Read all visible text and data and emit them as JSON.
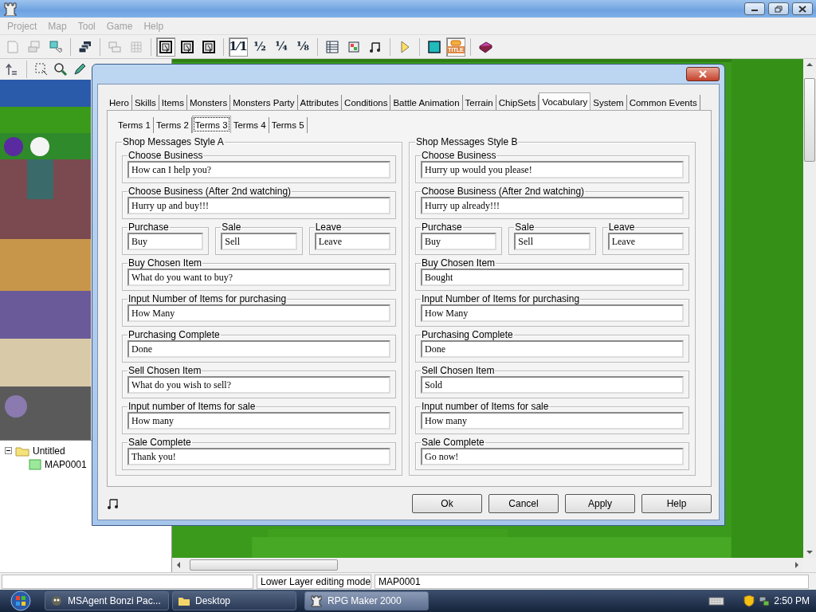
{
  "menu": [
    {
      "label": "Project",
      "disabled": true
    },
    {
      "label": "Map",
      "disabled": true
    },
    {
      "label": "Tool",
      "disabled": true
    },
    {
      "label": "Game",
      "disabled": true
    },
    {
      "label": "Help",
      "disabled": true
    }
  ],
  "toolbar": {
    "layer_buttons": [
      {
        "selected": true
      },
      {
        "selected": false
      },
      {
        "selected": false
      }
    ],
    "zoom_buttons": [
      {
        "label": "1⁄1",
        "selected": true
      },
      {
        "label": "½",
        "selected": false
      },
      {
        "label": "¼",
        "selected": false
      },
      {
        "label": "⅛",
        "selected": false
      }
    ],
    "title_button": {
      "label": "TITLE",
      "on": true
    }
  },
  "map_tree": [
    {
      "label": "Untitled",
      "expanded": true,
      "children": [
        {
          "label": "MAP0001"
        }
      ]
    }
  ],
  "dialog": {
    "tabs": [
      {
        "label": "Hero",
        "selected": false
      },
      {
        "label": "Skills",
        "selected": false
      },
      {
        "label": "Items",
        "selected": false
      },
      {
        "label": "Monsters",
        "selected": false
      },
      {
        "label": "Monsters Party",
        "selected": false
      },
      {
        "label": "Attributes",
        "selected": false
      },
      {
        "label": "Conditions",
        "selected": false
      },
      {
        "label": "Battle Animation",
        "selected": false
      },
      {
        "label": "Terrain",
        "selected": false
      },
      {
        "label": "ChipSets",
        "selected": false
      },
      {
        "label": "Vocabulary",
        "selected": true
      },
      {
        "label": "System",
        "selected": false
      },
      {
        "label": "Common Events",
        "selected": false
      }
    ],
    "subtabs": [
      {
        "label": "Terms 1",
        "selected": false
      },
      {
        "label": "Terms 2",
        "selected": false
      },
      {
        "label": "Terms 3",
        "selected": true
      },
      {
        "label": "Terms 4",
        "selected": false
      },
      {
        "label": "Terms 5",
        "selected": false
      }
    ],
    "groups": [
      {
        "title": "Shop Messages Style A",
        "fields": [
          {
            "kind": "single",
            "label": "Choose Business",
            "value": "How can I help you?"
          },
          {
            "kind": "single",
            "label": "Choose Business (After 2nd watching)",
            "value": "Hurry up and buy!!!"
          },
          {
            "kind": "triple",
            "items": [
              {
                "label": "Purchase",
                "value": "Buy"
              },
              {
                "label": "Sale",
                "value": "Sell"
              },
              {
                "label": "Leave",
                "value": "Leave"
              }
            ]
          },
          {
            "kind": "single",
            "label": "Buy Chosen Item",
            "value": "What do you want to buy?"
          },
          {
            "kind": "single",
            "label": "Input Number of Items for purchasing",
            "value": "How Many"
          },
          {
            "kind": "single",
            "label": "Purchasing Complete",
            "value": "Done"
          },
          {
            "kind": "single",
            "label": "Sell Chosen Item",
            "value": "What do you wish to sell?"
          },
          {
            "kind": "single",
            "label": "Input number of Items for sale",
            "value": "How many"
          },
          {
            "kind": "single",
            "label": "Sale Complete",
            "value": "Thank you!"
          }
        ]
      },
      {
        "title": "Shop Messages Style B",
        "fields": [
          {
            "kind": "single",
            "label": "Choose Business",
            "value": "Hurry up would you please!"
          },
          {
            "kind": "single",
            "label": "Choose Business (After 2nd watching)",
            "value": "Hurry up already!!!"
          },
          {
            "kind": "triple",
            "items": [
              {
                "label": "Purchase",
                "value": "Buy"
              },
              {
                "label": "Sale",
                "value": "Sell"
              },
              {
                "label": "Leave",
                "value": "Leave"
              }
            ]
          },
          {
            "kind": "single",
            "label": "Buy Chosen Item",
            "value": "Bought"
          },
          {
            "kind": "single",
            "label": "Input Number of Items for purchasing",
            "value": "How Many"
          },
          {
            "kind": "single",
            "label": "Purchasing Complete",
            "value": "Done"
          },
          {
            "kind": "single",
            "label": "Sell Chosen Item",
            "value": "Sold"
          },
          {
            "kind": "single",
            "label": "Input number of Items for sale",
            "value": "How many"
          },
          {
            "kind": "single",
            "label": "Sale Complete",
            "value": "Go now!"
          }
        ]
      }
    ],
    "buttons": [
      {
        "label": "Ok"
      },
      {
        "label": "Cancel"
      },
      {
        "label": "Apply"
      },
      {
        "label": "Help"
      }
    ]
  },
  "status_bar": [
    "Lower Layer editing mode",
    "MAP0001"
  ],
  "taskbar": {
    "items": [
      {
        "label": "MSAgent Bonzi Pac...",
        "selected": false
      },
      {
        "label": "Desktop",
        "selected": false
      },
      {
        "label": "RPG Maker 2000",
        "selected": true
      }
    ],
    "clock": "2:50 PM"
  }
}
